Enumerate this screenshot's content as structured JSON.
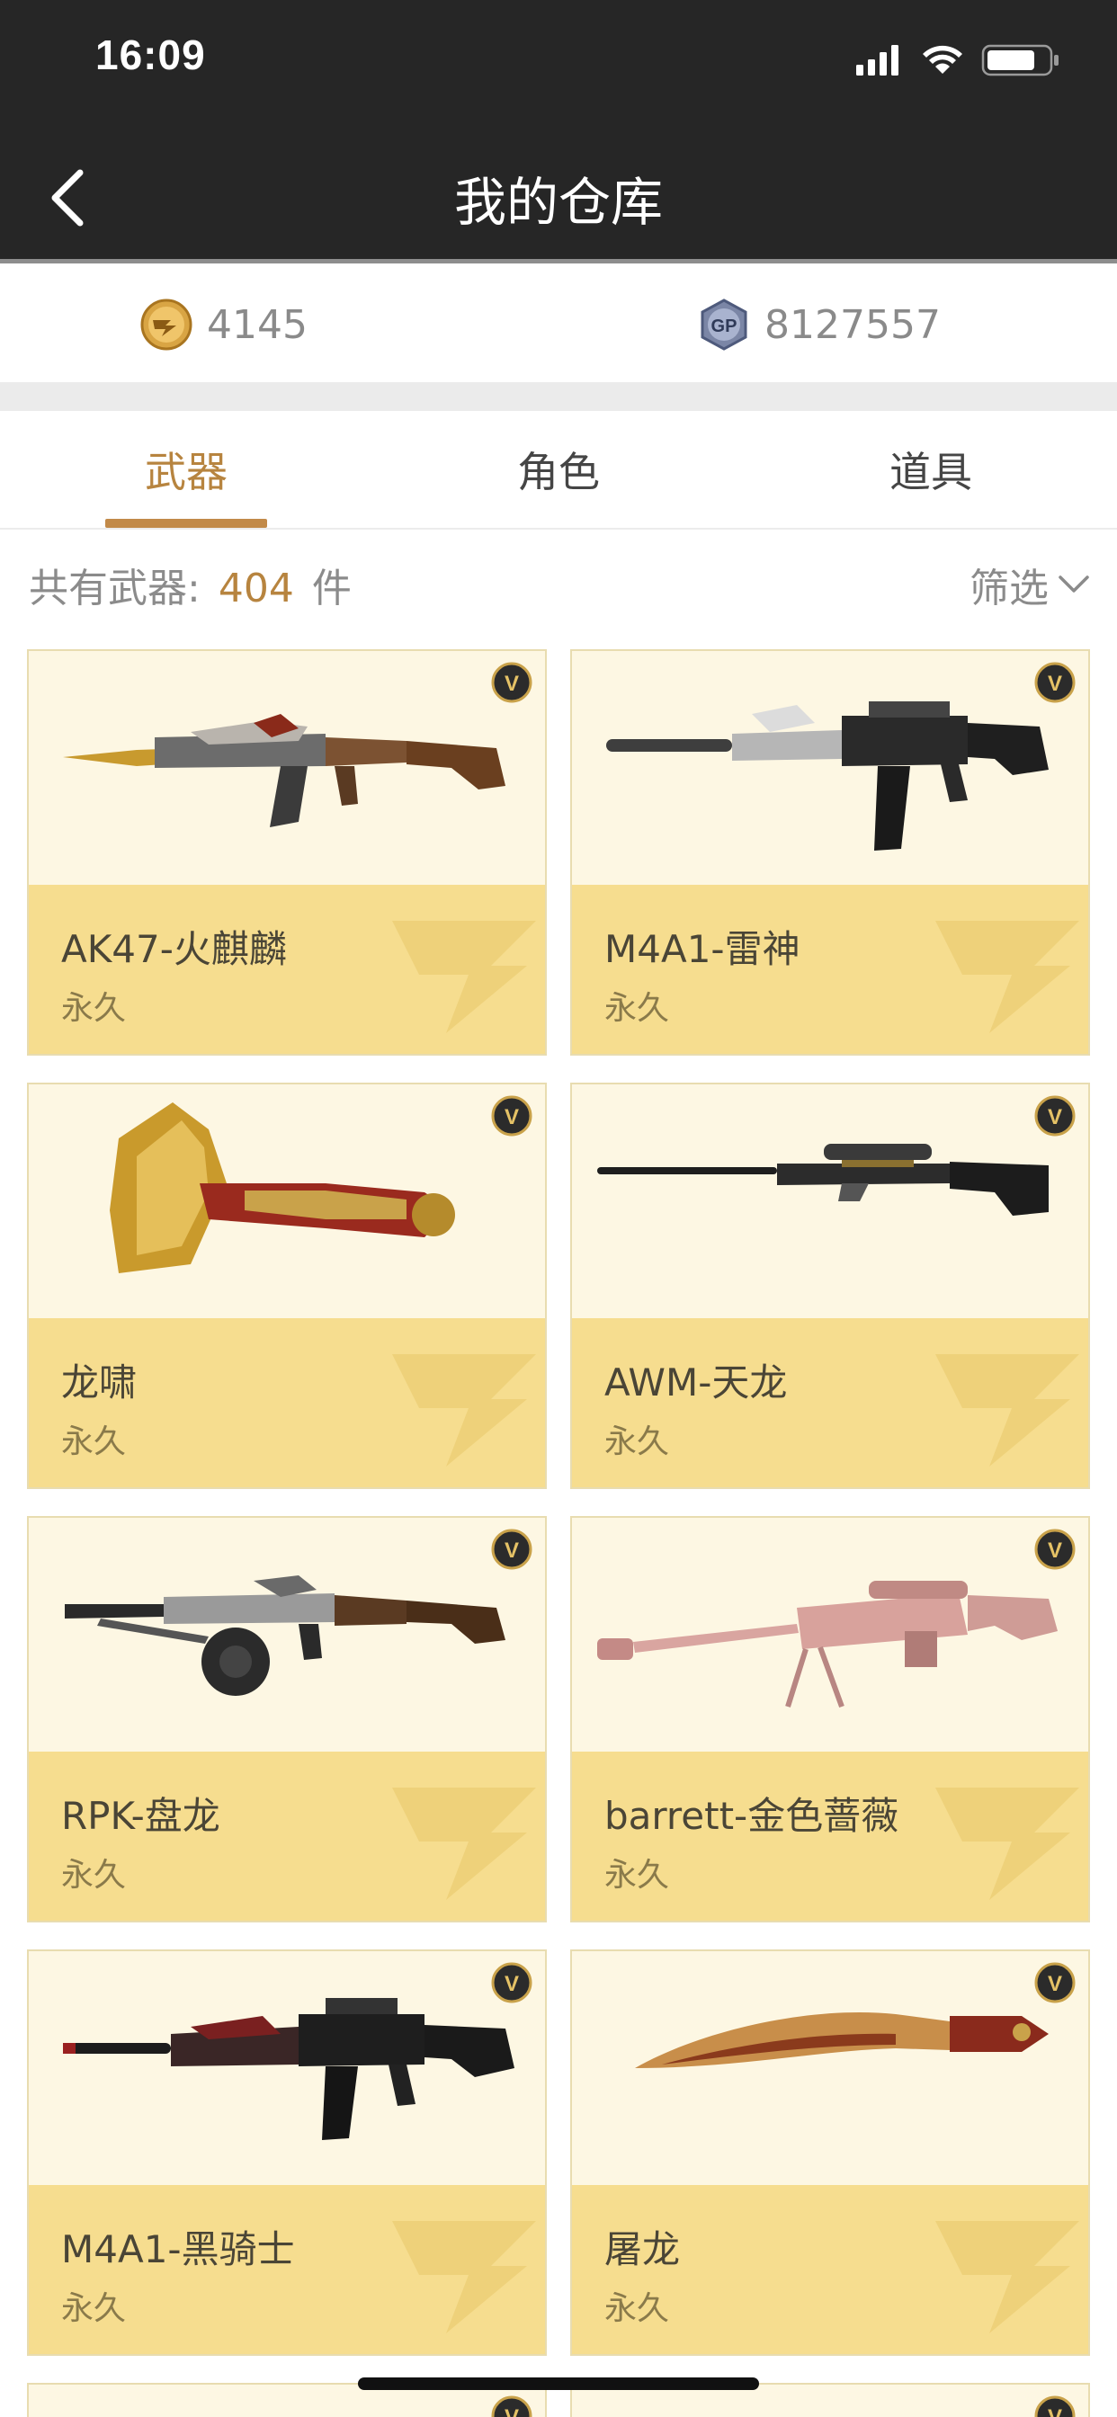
{
  "status_bar": {
    "time": "16:09"
  },
  "nav": {
    "title": "我的仓库"
  },
  "currency": {
    "cf_points": "4145",
    "gp_points": "8127557"
  },
  "tabs": [
    {
      "label": "武器",
      "active": true
    },
    {
      "label": "角色",
      "active": false
    },
    {
      "label": "道具",
      "active": false
    }
  ],
  "summary": {
    "prefix": "共有武器:",
    "count": "404",
    "suffix": "件",
    "filter_label": "筛选"
  },
  "items": [
    {
      "name": "AK47-火麒麟",
      "duration": "永久",
      "icon": "ak47-rifle-icon"
    },
    {
      "name": "M4A1-雷神",
      "duration": "永久",
      "icon": "m4a1-rifle-icon"
    },
    {
      "name": "龙啸",
      "duration": "永久",
      "icon": "dragon-axe-icon"
    },
    {
      "name": "AWM-天龙",
      "duration": "永久",
      "icon": "sniper-rifle-icon"
    },
    {
      "name": "RPK-盘龙",
      "duration": "永久",
      "icon": "rpk-rifle-icon"
    },
    {
      "name": "barrett-金色蔷薇",
      "duration": "永久",
      "icon": "barrett-rifle-icon"
    },
    {
      "name": "M4A1-黑骑士",
      "duration": "永久",
      "icon": "m4a1-black-rifle-icon"
    },
    {
      "name": "屠龙",
      "duration": "永久",
      "icon": "kukri-knife-icon"
    }
  ],
  "colors": {
    "accent": "#b7843f",
    "card_bg": "#fdf7e3",
    "card_info": "#f6dd8f",
    "nav_bg": "#262626"
  }
}
